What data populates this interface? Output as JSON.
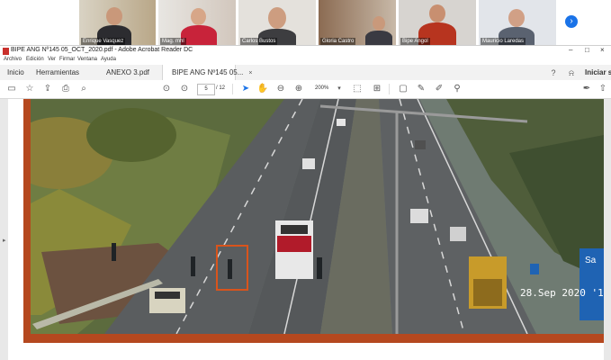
{
  "meeting": {
    "participants": [
      {
        "name": "Enrique Vasquez"
      },
      {
        "name": "Mag. mhl"
      },
      {
        "name": "Carlos Bustos"
      },
      {
        "name": "Gloria Castro"
      },
      {
        "name": "Bipe Angol"
      },
      {
        "name": "Mauricio Laredas"
      }
    ],
    "next_icon": "chevron-right-icon"
  },
  "window": {
    "title": "BIPE ANG Nº145 05_OCT_2020.pdf - Adobe Acrobat Reader DC"
  },
  "menu": {
    "items": [
      "Archivo",
      "Edición",
      "Ver",
      "Firmar",
      "Ventana",
      "Ayuda"
    ]
  },
  "tabs": {
    "home": "Inicio",
    "tools": "Herramientas",
    "doc1": "ANEXO 3.pdf",
    "doc2": "BIPE ANG Nº145 05...",
    "close_symbol": "×",
    "signin": "Iniciar s"
  },
  "toolbar": {
    "page_current": "5",
    "page_total": "/ 12",
    "zoom": "200%"
  },
  "photo": {
    "timestamp": "28.Sep 2020 '1"
  },
  "colors": {
    "accent": "#1a73e8",
    "frame": "#b5481f",
    "highlight_box": "#d9541c"
  }
}
